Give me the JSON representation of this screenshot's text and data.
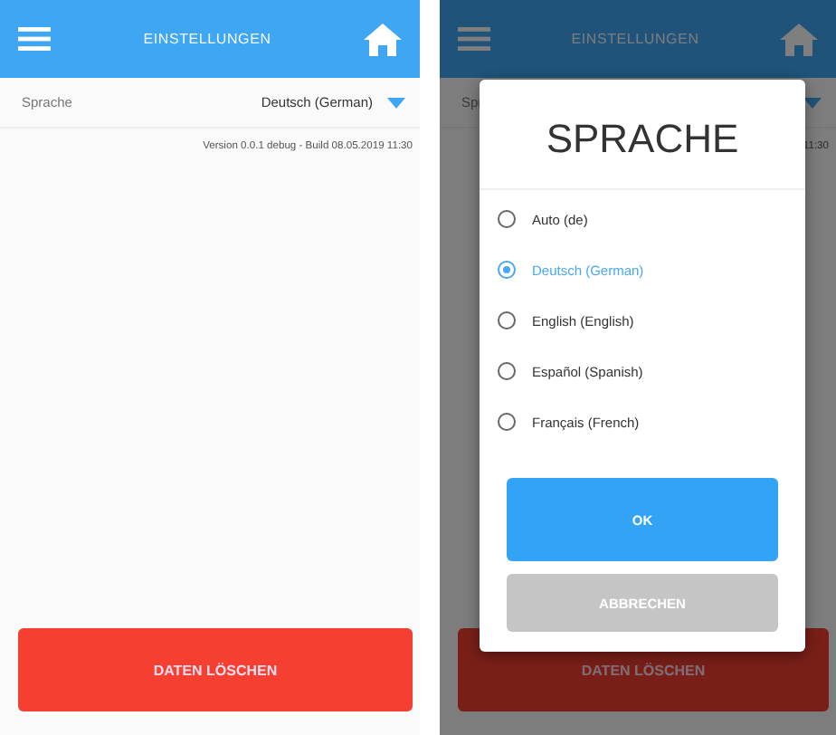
{
  "settings_screen": {
    "header_title": "EINSTELLUNGEN",
    "setting_label": "Sprache",
    "setting_value": "Deutsch (German)",
    "version": "Version 0.0.1 debug - Build 08.05.2019 11:30",
    "action": "DATEN LÖSCHEN"
  },
  "dialog_screen": {
    "header_title": "EINSTELLUNGEN",
    "setting_label": "Spr",
    "version": "11:30",
    "action": "DATEN LÖSCHEN",
    "dialog": {
      "title": "SPRACHE",
      "options": [
        {
          "label": "Auto (de)",
          "selected": false
        },
        {
          "label": "Deutsch (German)",
          "selected": true
        },
        {
          "label": "English (English)",
          "selected": false
        },
        {
          "label": "Español (Spanish)",
          "selected": false
        },
        {
          "label": "Français (French)",
          "selected": false
        }
      ],
      "buttons": [
        {
          "label": "OK",
          "kind": "primary"
        },
        {
          "label": "ABBRECHEN",
          "kind": "secondary"
        }
      ]
    }
  }
}
